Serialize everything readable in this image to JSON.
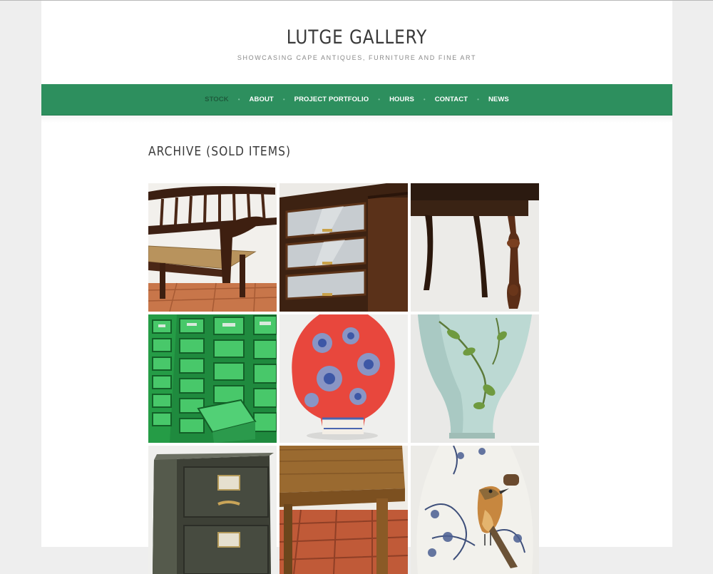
{
  "site": {
    "title": "LUTGE GALLERY",
    "tagline": "SHOWCASING CAPE ANTIQUES, FURNITURE AND FINE ART"
  },
  "nav": {
    "items": [
      {
        "label": "STOCK",
        "current": true
      },
      {
        "label": "ABOUT"
      },
      {
        "label": "PROJECT PORTFOLIO"
      },
      {
        "label": "HOURS"
      },
      {
        "label": "CONTACT"
      },
      {
        "label": "NEWS"
      }
    ],
    "separator": "•"
  },
  "page": {
    "title": "ARCHIVE (SOLD ITEMS)"
  },
  "gallery": {
    "items": [
      {
        "subject": "wooden-bench-with-cane-seat"
      },
      {
        "subject": "glass-front-display-cabinet"
      },
      {
        "subject": "dark-wooden-side-table"
      },
      {
        "subject": "green-metal-filing-drawers"
      },
      {
        "subject": "red-and-blue-floral-vase"
      },
      {
        "subject": "pale-blue-painted-vase"
      },
      {
        "subject": "green-metal-filing-cabinet"
      },
      {
        "subject": "yellowwood-table-on-terracotta-floor"
      },
      {
        "subject": "bird-painted-ceramic-vase"
      }
    ]
  },
  "colors": {
    "nav_background": "#2d8f5e",
    "page_background": "#eeeeee",
    "content_background": "#ffffff",
    "heading_text": "#3a3a3a"
  }
}
